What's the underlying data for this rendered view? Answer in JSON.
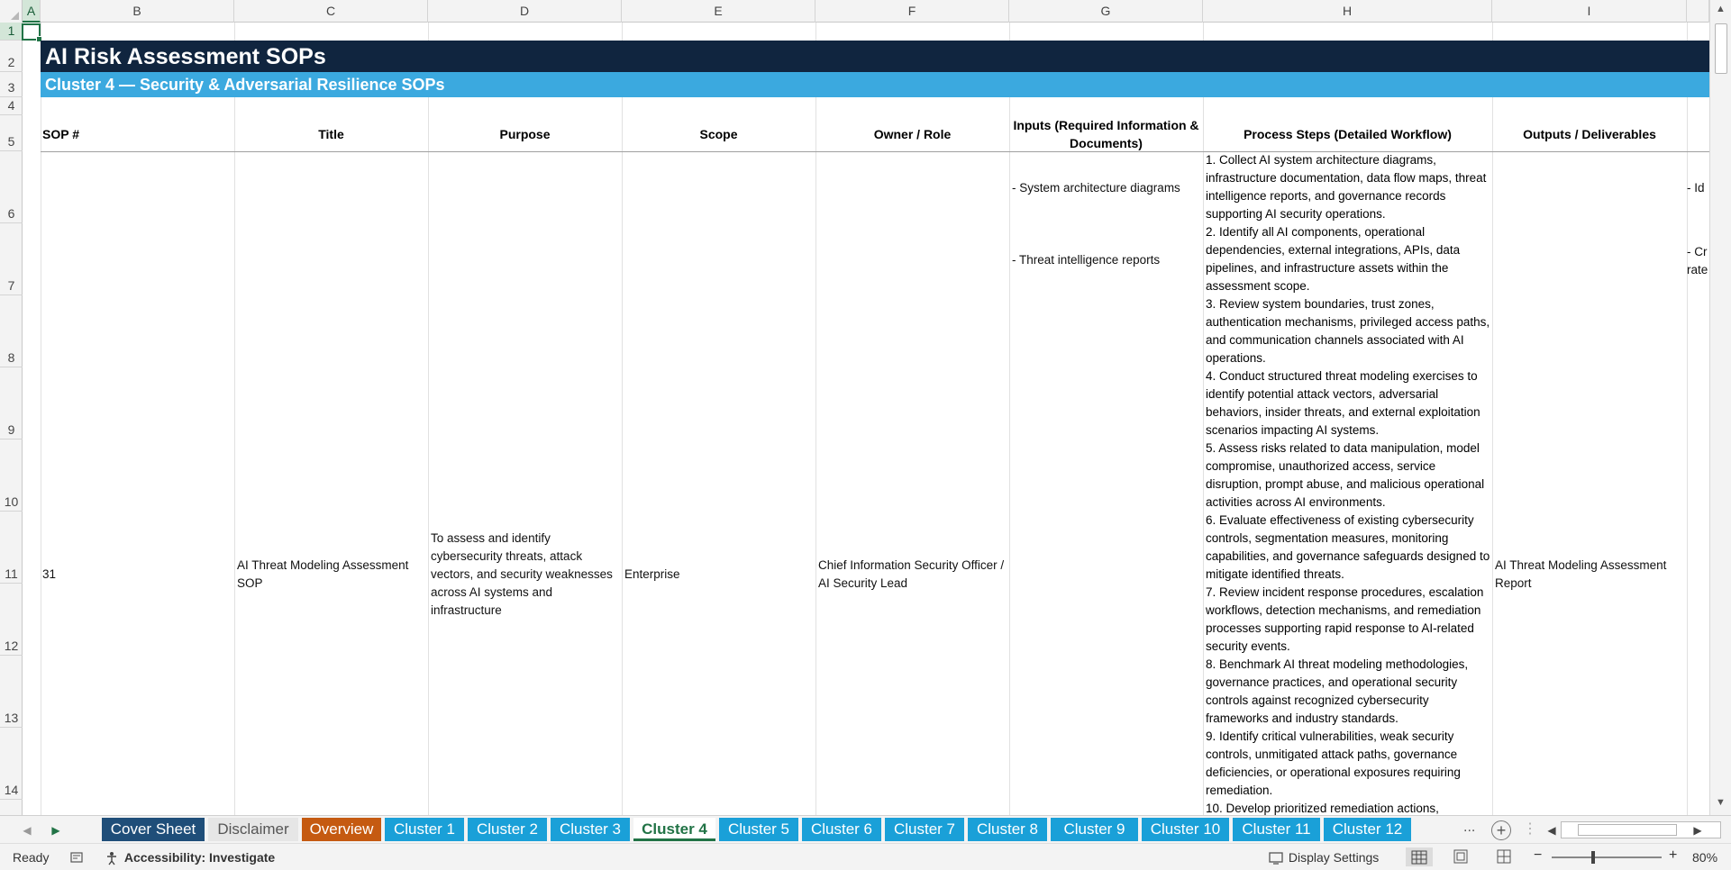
{
  "sheet": {
    "columns": [
      "A",
      "B",
      "C",
      "D",
      "E",
      "F",
      "G",
      "H",
      "I"
    ],
    "rows": [
      "1",
      "2",
      "3",
      "4",
      "5",
      "6",
      "7",
      "8",
      "9",
      "10",
      "11",
      "12",
      "13",
      "14"
    ],
    "title": "AI Risk Assessment SOPs",
    "subtitle": "Cluster 4 — Security & Adversarial Resilience SOPs",
    "headers": {
      "sop": "SOP #",
      "title": "Title",
      "purpose": "Purpose",
      "scope": "Scope",
      "owner": "Owner / Role",
      "inputs": "Inputs (Required Information & Documents)",
      "process": "Process Steps (Detailed Workflow)",
      "outputs": "Outputs / Deliverables"
    },
    "record": {
      "sop": "31",
      "title": "AI Threat Modeling Assessment SOP",
      "purpose": "To assess and identify cybersecurity threats, attack vectors, and security weaknesses across AI systems and infrastructure",
      "scope": "Enterprise",
      "owner": "Chief Information Security Officer / AI Security Lead",
      "inputs": [
        "- System architecture diagrams",
        "- Threat intelligence reports"
      ],
      "process_steps": [
        "1. Collect AI system architecture diagrams, infrastructure documentation, data flow maps, threat intelligence reports, and governance records supporting AI security operations.",
        "2. Identify all AI components, operational dependencies, external integrations, APIs, data pipelines, and infrastructure assets within the assessment scope.",
        "3. Review system boundaries, trust zones, authentication mechanisms, privileged access paths, and communication channels associated with AI operations.",
        "4. Conduct structured threat modeling exercises to identify potential attack vectors, adversarial behaviors, insider threats, and external exploitation scenarios impacting AI systems.",
        "5. Assess risks related to data manipulation, model compromise, unauthorized access, service disruption, prompt abuse, and malicious operational activities across AI environments.",
        "6. Evaluate effectiveness of existing cybersecurity controls, segmentation measures, monitoring capabilities, and governance safeguards designed to mitigate identified threats.",
        "7. Review incident response procedures, escalation workflows, detection mechanisms, and remediation processes supporting rapid response to AI-related security events.",
        "8. Benchmark AI threat modeling methodologies, governance practices, and operational security controls against recognized cybersecurity frameworks and industry standards.",
        "9. Identify critical vulnerabilities, weak security controls, unmitigated attack paths, governance deficiencies, or operational exposures requiring remediation.",
        "10. Develop prioritized remediation actions,"
      ],
      "outputs": "AI Threat Modeling Assessment Report",
      "next_col_fragments": [
        "- Id",
        "- Cr",
        "rate"
      ]
    }
  },
  "tabs": [
    "Cover Sheet",
    "Disclaimer",
    "Overview",
    "Cluster 1",
    "Cluster 2",
    "Cluster 3",
    "Cluster 4",
    "Cluster 5",
    "Cluster 6",
    "Cluster 7",
    "Cluster 8",
    "Cluster 9",
    "Cluster 10",
    "Cluster 11",
    "Cluster 12"
  ],
  "tab_colors": {
    "cover": "#1f4e79",
    "disclaimer": "#e6e6e6",
    "overview": "#c55a11",
    "cluster": "#1aa0d8",
    "active": "#217346"
  },
  "tab_more": "...",
  "status": {
    "ready": "Ready",
    "accessibility": "Accessibility: Investigate",
    "display_settings": "Display Settings",
    "zoom": "80%"
  }
}
